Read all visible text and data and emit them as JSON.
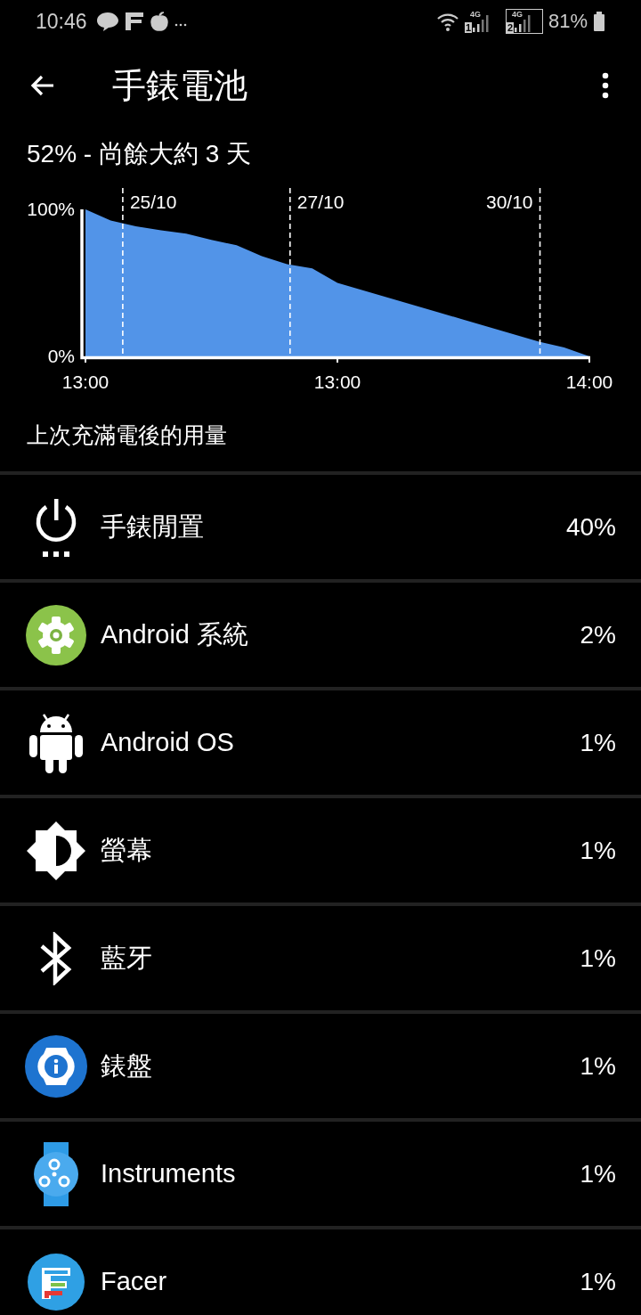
{
  "status_bar": {
    "time": "10:46",
    "sims": [
      {
        "network": "4G",
        "slot": "1"
      },
      {
        "network": "4G",
        "slot": "2"
      }
    ],
    "battery": "81%"
  },
  "app_bar": {
    "title": "手錶電池"
  },
  "summary": "52% - 尚餘大約 3 天",
  "chart_data": {
    "type": "area",
    "categories": [
      "13:00",
      null,
      null,
      null,
      null,
      null,
      null,
      null,
      null,
      null,
      "13:00",
      null,
      null,
      null,
      null,
      null,
      null,
      null,
      null,
      null,
      "14:00"
    ],
    "series": [
      {
        "color": "#5294e8",
        "values": [
          100,
          92.5,
          88.5,
          85.7,
          83.5,
          79.3,
          75.6,
          68.2,
          62.8,
          59.8,
          50,
          45,
          40,
          35,
          30,
          25,
          20,
          15,
          10,
          6,
          0
        ]
      }
    ],
    "ylim": [
      0,
      100
    ],
    "yticks": [
      {
        "value": 0,
        "label": "0%"
      },
      {
        "value": 100,
        "label": "100%"
      }
    ],
    "annotations": [
      "25/10",
      "27/10",
      "30/10"
    ]
  },
  "section_title": "上次充滿電後的用量",
  "usage": [
    {
      "kind": "power",
      "name": "手錶閒置",
      "percent": "40%"
    },
    {
      "kind": "system",
      "name": "Android 系統",
      "percent": "2%"
    },
    {
      "kind": "android",
      "name": "Android OS",
      "percent": "1%"
    },
    {
      "kind": "screen",
      "name": "螢幕",
      "percent": "1%"
    },
    {
      "kind": "bluetooth",
      "name": "藍牙",
      "percent": "1%"
    },
    {
      "kind": "watchface",
      "name": "錶盤",
      "percent": "1%"
    },
    {
      "kind": "instruments",
      "name": "Instruments",
      "percent": "1%"
    },
    {
      "kind": "facer",
      "name": "Facer",
      "percent": "1%"
    }
  ]
}
